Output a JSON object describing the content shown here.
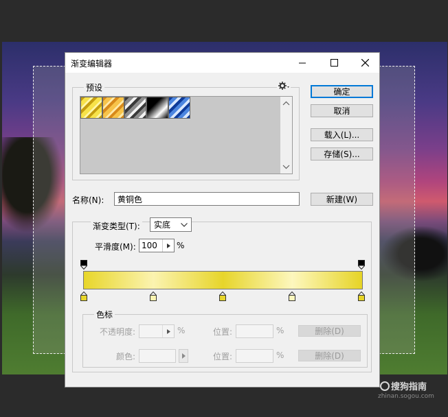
{
  "dialog": {
    "title": "渐变编辑器",
    "buttons": {
      "ok": "确定",
      "cancel": "取消",
      "load": "载入(L)...",
      "save": "存储(S)...",
      "new": "新建(W)"
    },
    "presets": {
      "legend": "预设",
      "swatches": [
        {
          "icon": "gold-diagonal-gradient"
        },
        {
          "icon": "orange-gold-diagonal-gradient"
        },
        {
          "icon": "silver-diagonal-gradient"
        },
        {
          "icon": "black-white-gradient"
        },
        {
          "icon": "blue-diagonal-gradient"
        }
      ]
    },
    "name": {
      "label": "名称(N):",
      "value": "黄铜色"
    },
    "gradient_type": {
      "label": "渐变类型(T):",
      "value": "实底"
    },
    "smoothness": {
      "label": "平滑度(M):",
      "value": "100",
      "unit": "%"
    },
    "gradient_bar": {
      "colors": [
        "#e8d62a",
        "#fbf3b0",
        "#e7d52b",
        "#fdf7be",
        "#e6d426"
      ],
      "opacity_stops": [
        0,
        100
      ],
      "color_stops": [
        0,
        25,
        50,
        75,
        100
      ]
    },
    "color_stop_group": {
      "legend": "色标",
      "opacity_label": "不透明度:",
      "opacity_unit": "%",
      "position_label_1": "位置:",
      "position_unit_1": "%",
      "delete_label_1": "删除(D)",
      "color_label": "颜色:",
      "position_label_2": "位置:",
      "position_unit_2": "%",
      "delete_label_2": "删除(D)"
    }
  },
  "watermark": {
    "text": "搜狗指南",
    "url": "zhinan.sogou.com"
  }
}
